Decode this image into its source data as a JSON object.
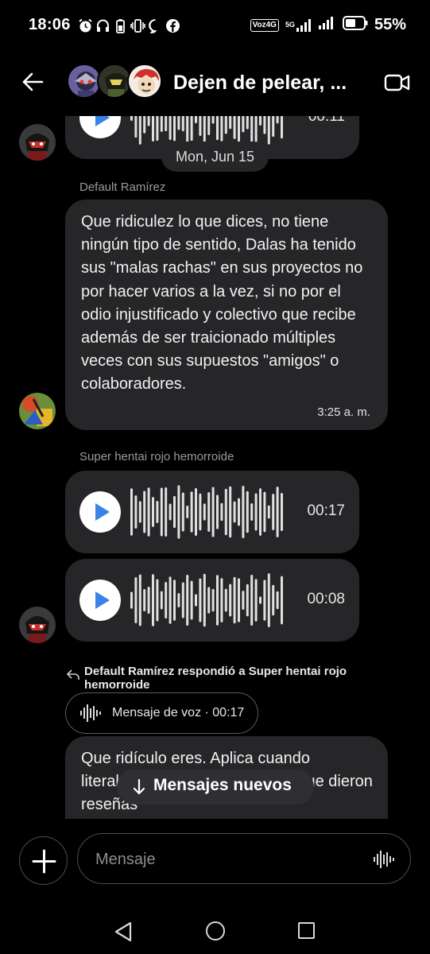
{
  "status_bar": {
    "time": "18:06",
    "network_badge": "Voz4G",
    "network_gen": "5G",
    "battery_percent": "55%",
    "left_icons": [
      "alarm-icon",
      "headphones-icon",
      "battery-saver-icon",
      "vibrate-icon",
      "chat-bubble-icon",
      "facebook-icon"
    ]
  },
  "header": {
    "title": "Dejen de pelear, ...",
    "back_icon": "back-arrow-icon",
    "video_icon": "video-call-icon"
  },
  "date_separator": "Mon, Jun 15",
  "messages": [
    {
      "sender": "Default Ramírez",
      "text": "Que ridiculez lo que dices, no tiene ningún tipo de sentido, Dalas ha tenido sus \"malas rachas\" en sus proyectos no por hacer varios a la vez, si no por el odio injustificado y colectivo que recibe además de ser traicionado múltiples veces con sus supuestos \"amigos\" o colaboradores.",
      "time": "3:25 a. m."
    },
    {
      "sender": "Super hentai rojo hemorroide",
      "voice_notes": [
        {
          "duration": "00:17"
        },
        {
          "duration": "00:08"
        }
      ]
    }
  ],
  "top_voice_duration": "00:11",
  "reply": {
    "label": "Default Ramírez respondió a Super hentai rojo hemorroide",
    "quoted": "Mensaje de voz · 00:17"
  },
  "last_message_text": "Que ridículo eres. Aplica cuando literalmente los que fueron los que dieron reseñas",
  "new_messages_button": "Mensajes nuevos",
  "composer": {
    "placeholder": "Mensaje"
  },
  "colors": {
    "background": "#000000",
    "bubble": "#262629",
    "play_icon": "#3b82e6",
    "secondary_text": "#9a9a9e"
  }
}
